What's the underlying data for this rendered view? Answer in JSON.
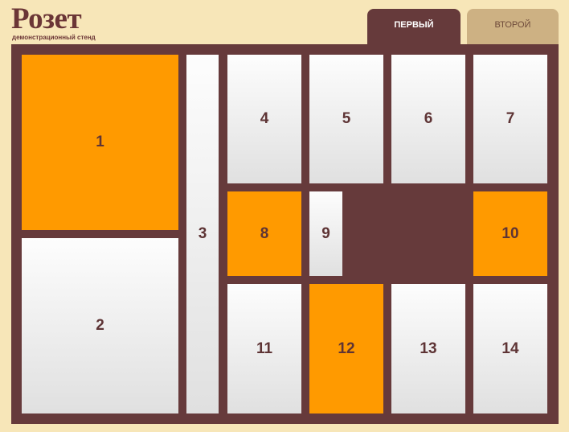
{
  "logo": {
    "title": "Розет",
    "subtitle": "демонстрационный стенд"
  },
  "tabs": [
    {
      "label": "ПЕРВЫЙ",
      "active": true
    },
    {
      "label": "ВТОРОЙ",
      "active": false
    }
  ],
  "cells": [
    {
      "label": "1",
      "state": "orange"
    },
    {
      "label": "2",
      "state": "gray"
    },
    {
      "label": "3",
      "state": "gray"
    },
    {
      "label": "4",
      "state": "gray"
    },
    {
      "label": "5",
      "state": "gray"
    },
    {
      "label": "6",
      "state": "gray"
    },
    {
      "label": "7",
      "state": "gray"
    },
    {
      "label": "8",
      "state": "orange"
    },
    {
      "label": "9",
      "state": "gray"
    },
    {
      "label": "10",
      "state": "orange"
    },
    {
      "label": "11",
      "state": "gray"
    },
    {
      "label": "12",
      "state": "orange"
    },
    {
      "label": "13",
      "state": "gray"
    },
    {
      "label": "14",
      "state": "gray"
    }
  ],
  "colors": {
    "background": "#f7e6b8",
    "board": "#663a3b",
    "accent": "#ff9a00",
    "inactive_tab": "#cdb183"
  }
}
